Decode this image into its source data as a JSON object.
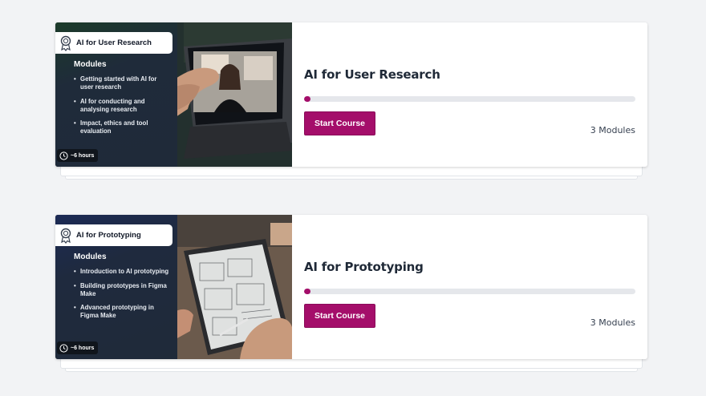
{
  "courses": [
    {
      "badge_title": "AI for User Research",
      "modules_heading": "Modules",
      "modules": [
        "Getting started with AI for user research",
        "AI for conducting and analysing research",
        "Impact, ethics and tool evaluation"
      ],
      "duration": "~6 hours",
      "title": "AI for User Research",
      "progress": 0.02,
      "button_label": "Start Course",
      "module_count": "3 Modules",
      "thumbnail_scene": "video-call-laptop"
    },
    {
      "badge_title": "AI for Prototyping",
      "modules_heading": "Modules",
      "modules": [
        "Introduction to AI prototyping",
        "Building prototypes in Figma Make",
        "Advanced prototyping in Figma Make"
      ],
      "duration": "~6 hours",
      "title": "AI for Prototyping",
      "progress": 0.02,
      "button_label": "Start Course",
      "module_count": "3 Modules",
      "thumbnail_scene": "tablet-sketching"
    }
  ],
  "colors": {
    "accent": "#a40e6a",
    "page_bg": "#f2f3f5",
    "panel_bg": "#1f2a39",
    "progress_track": "#e5e7eb"
  },
  "icons": {
    "badge": "award-ribbon-icon",
    "duration": "clock-icon"
  }
}
